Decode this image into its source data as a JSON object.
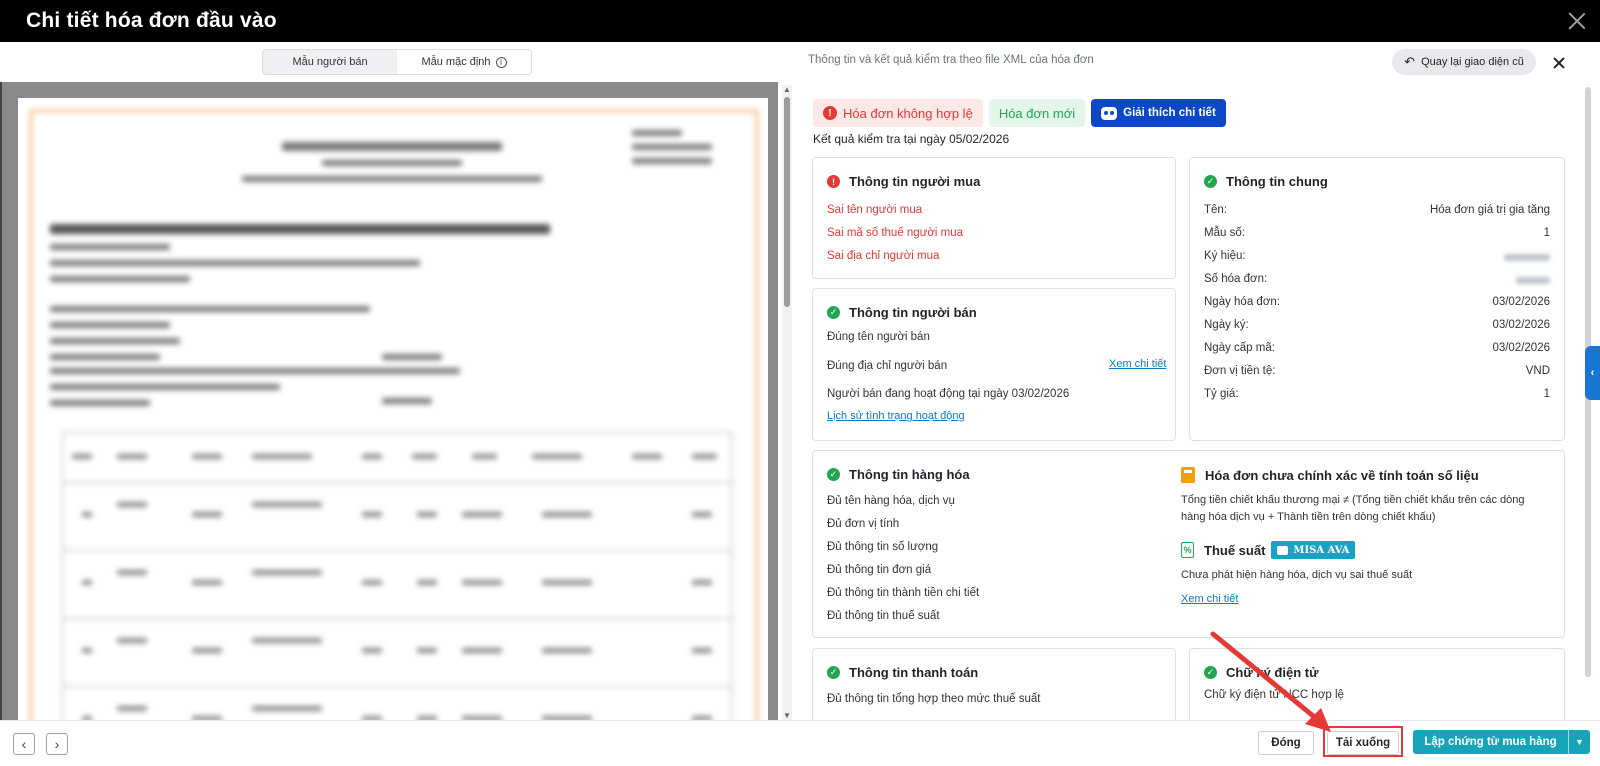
{
  "window": {
    "title": "Chi tiết hóa đơn đầu vào"
  },
  "header": {
    "tabs": [
      {
        "label": "Mẫu người bán",
        "active": false
      },
      {
        "label": "Mẫu mặc định",
        "active": true
      }
    ],
    "caption": "Thông tin và kết quả kiểm tra theo file XML của hóa đơn",
    "back_label": "Quay lại giao diện cũ"
  },
  "status": {
    "invalid_label": "Hóa đơn không hợp lệ",
    "new_label": "Hóa đơn mới",
    "explain_label": "Giải thích chi tiết",
    "checked_date": "Kết quả kiểm tra tại ngày 05/02/2026"
  },
  "buyer": {
    "title": "Thông tin người mua",
    "errors": [
      "Sai tên người mua",
      "Sai mã số thuế người mua",
      "Sai địa chỉ người mua"
    ]
  },
  "general": {
    "title": "Thông tin chung",
    "rows": [
      {
        "label": "Tên:",
        "value": "Hóa đơn giá trị gia tăng"
      },
      {
        "label": "Mẫu số:",
        "value": "1"
      },
      {
        "label": "Ký hiệu:",
        "value": ""
      },
      {
        "label": "Số hóa đơn:",
        "value": ""
      },
      {
        "label": "Ngày hóa đơn:",
        "value": "03/02/2026"
      },
      {
        "label": "Ngày ký:",
        "value": "03/02/2026"
      },
      {
        "label": "Ngày cấp mã:",
        "value": "03/02/2026"
      },
      {
        "label": "Đơn vị tiền tệ:",
        "value": "VND"
      },
      {
        "label": "Tỷ giá:",
        "value": "1"
      }
    ]
  },
  "seller": {
    "title": "Thông tin người bán",
    "line1": "Đúng tên người bán",
    "line2": "Đúng địa chỉ người bán",
    "detail_link": "Xem chi tiết",
    "line3": "Người bán đang hoạt động tại ngày 03/02/2026",
    "history_link": "Lịch sử tình trạng hoạt động"
  },
  "goods": {
    "title": "Thông tin hàng hóa",
    "items": [
      "Đủ tên hàng hóa, dịch vụ",
      "Đủ đơn vị tính",
      "Đủ thông tin số lượng",
      "Đủ thông tin đơn giá",
      "Đủ thông tin thành tiền chi tiết",
      "Đủ thông tin thuế suất"
    ]
  },
  "calc": {
    "title": "Hóa đơn chưa chính xác về tính toán số liệu",
    "desc_line1": "Tổng tiền chiết khấu thương mại ≠ (Tổng tiền chiết khấu trên các dòng",
    "desc_line2": "hàng hóa dịch vụ + Thành tiền trên dòng chiết khấu)",
    "tax_title": "Thuế suất",
    "misa_badge": "MISA AVA",
    "tax_desc": "Chưa phát hiện hàng hóa, dịch vụ sai thuế suất",
    "detail_link": "Xem chi tiết"
  },
  "payment": {
    "title": "Thông tin thanh toán",
    "line1": "Đủ thông tin tổng hợp theo mức thuế suất"
  },
  "signature": {
    "title": "Chữ ký điện tử",
    "line1": "Chữ ký điện tử NCC hợp lệ"
  },
  "footer": {
    "close_label": "Đóng",
    "download_label": "Tải xuống",
    "primary_label": "Lập chứng từ mua hàng"
  },
  "colors": {
    "accent": "#16a4b8",
    "error": "#e53935",
    "ok": "#22a652",
    "brand_blue": "#0d47c9"
  }
}
